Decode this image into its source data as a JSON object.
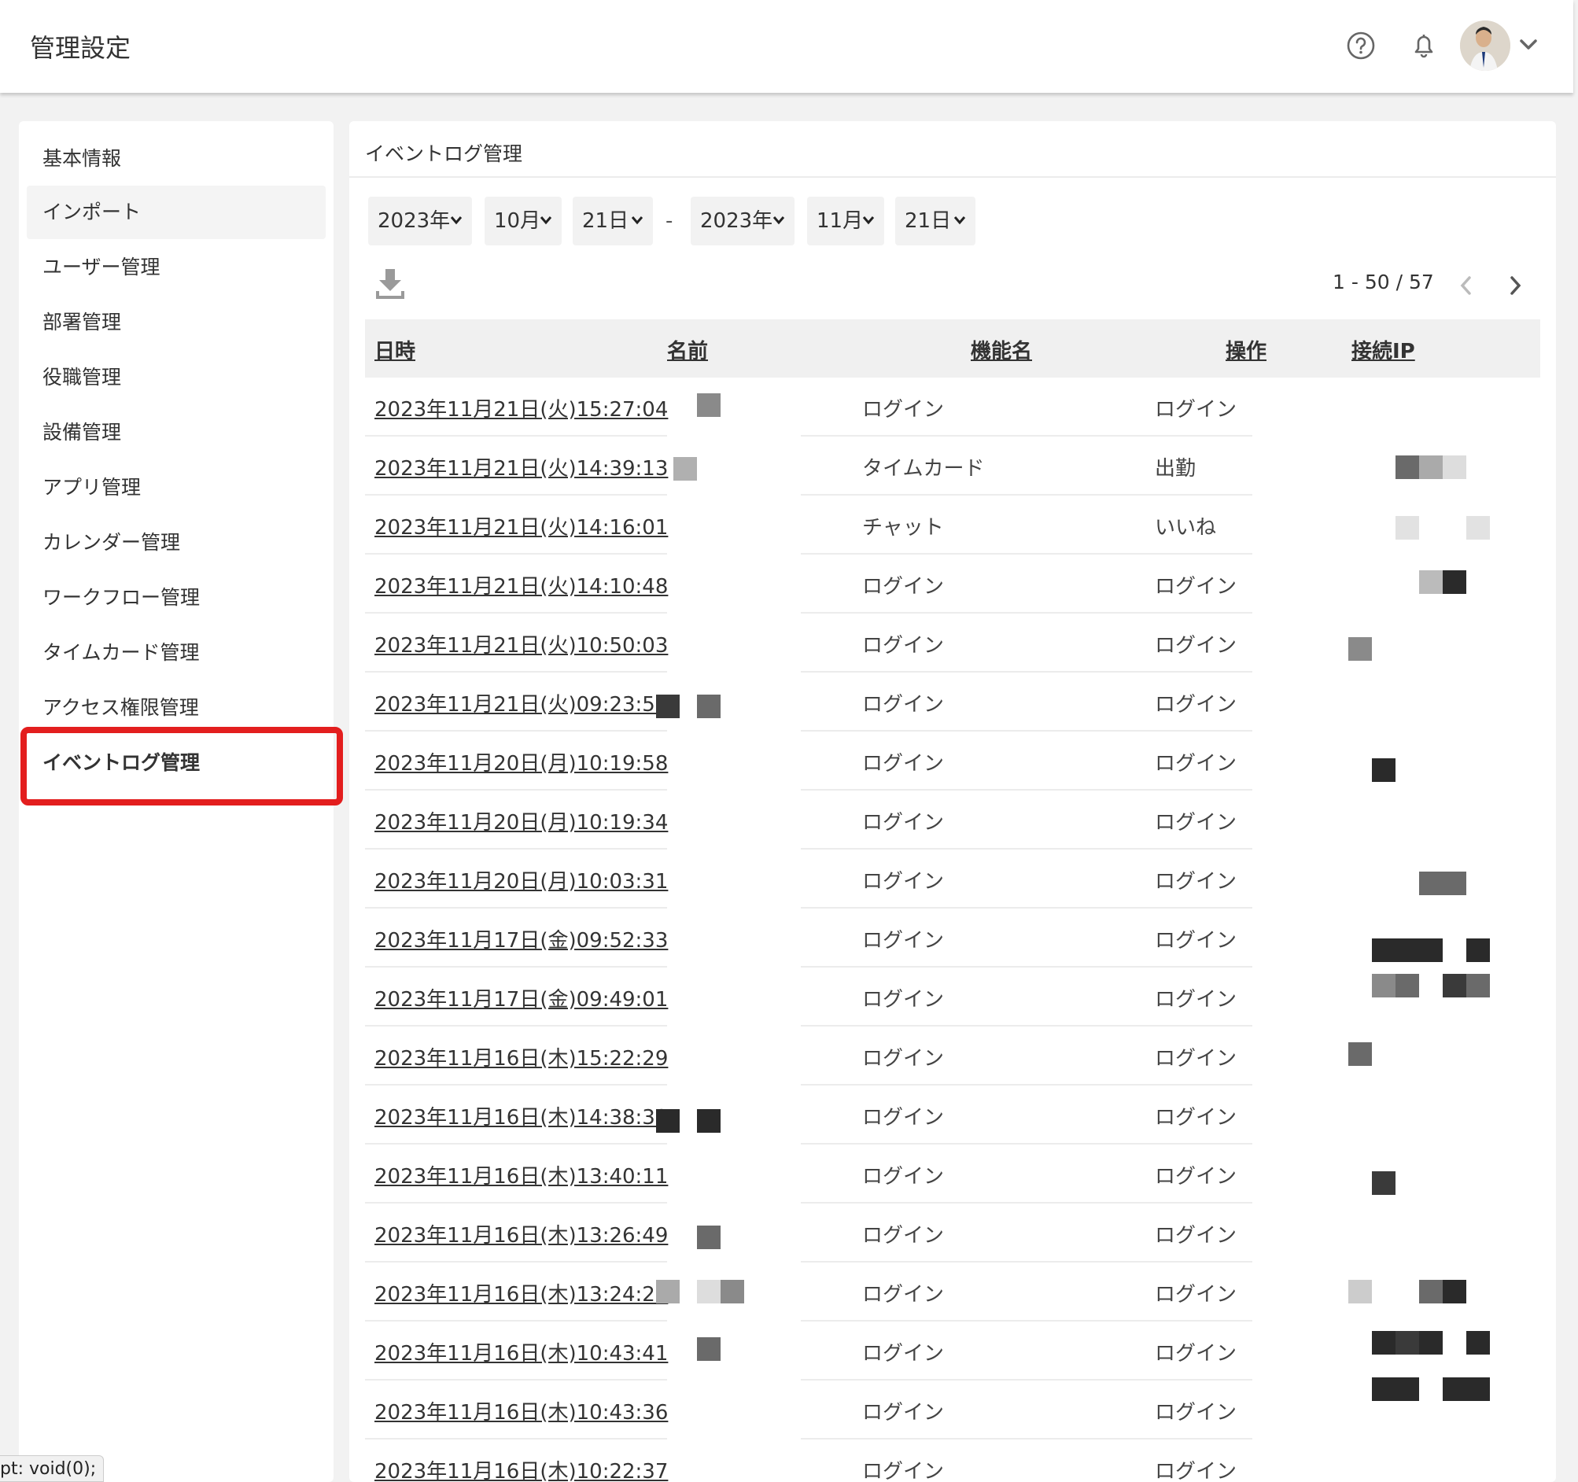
{
  "header": {
    "title": "管理設定",
    "icons": [
      "help-icon",
      "bell-icon",
      "avatar",
      "chevron-down-icon"
    ]
  },
  "sidebar": {
    "items": [
      {
        "label": "基本情報"
      },
      {
        "label": "インポート"
      },
      {
        "label": "ユーザー管理"
      },
      {
        "label": "部署管理"
      },
      {
        "label": "役職管理"
      },
      {
        "label": "設備管理"
      },
      {
        "label": "アプリ管理"
      },
      {
        "label": "カレンダー管理"
      },
      {
        "label": "ワークフロー管理"
      },
      {
        "label": "タイムカード管理"
      },
      {
        "label": "アクセス権限管理"
      },
      {
        "label": "イベントログ管理"
      }
    ],
    "active_index": 11,
    "highlight_color": "#e31e1e"
  },
  "main": {
    "title": "イベントログ管理",
    "filters": {
      "from": {
        "year": "2023年",
        "month": "10月",
        "day": "21日"
      },
      "separator": "-",
      "to": {
        "year": "2023年",
        "month": "11月",
        "day": "21日"
      }
    },
    "pager": "1 - 50 / 57",
    "columns": [
      "日時",
      "名前",
      "機能名",
      "操作",
      "接続IP"
    ],
    "rows": [
      {
        "datetime": "2023年11月21日(火)15:27:04",
        "function": "ログイン",
        "operation": "ログイン"
      },
      {
        "datetime": "2023年11月21日(火)14:39:13",
        "function": "タイムカード",
        "operation": "出勤"
      },
      {
        "datetime": "2023年11月21日(火)14:16:01",
        "function": "チャット",
        "operation": "いいね"
      },
      {
        "datetime": "2023年11月21日(火)14:10:48",
        "function": "ログイン",
        "operation": "ログイン"
      },
      {
        "datetime": "2023年11月21日(火)10:50:03",
        "function": "ログイン",
        "operation": "ログイン"
      },
      {
        "datetime": "2023年11月21日(火)09:23:52",
        "function": "ログイン",
        "operation": "ログイン"
      },
      {
        "datetime": "2023年11月20日(月)10:19:58",
        "function": "ログイン",
        "operation": "ログイン"
      },
      {
        "datetime": "2023年11月20日(月)10:19:34",
        "function": "ログイン",
        "operation": "ログイン"
      },
      {
        "datetime": "2023年11月20日(月)10:03:31",
        "function": "ログイン",
        "operation": "ログイン"
      },
      {
        "datetime": "2023年11月17日(金)09:52:33",
        "function": "ログイン",
        "operation": "ログイン"
      },
      {
        "datetime": "2023年11月17日(金)09:49:01",
        "function": "ログイン",
        "operation": "ログイン"
      },
      {
        "datetime": "2023年11月16日(木)15:22:29",
        "function": "ログイン",
        "operation": "ログイン"
      },
      {
        "datetime": "2023年11月16日(木)14:38:39",
        "function": "ログイン",
        "operation": "ログイン"
      },
      {
        "datetime": "2023年11月16日(木)13:40:11",
        "function": "ログイン",
        "operation": "ログイン"
      },
      {
        "datetime": "2023年11月16日(木)13:26:49",
        "function": "ログイン",
        "operation": "ログイン"
      },
      {
        "datetime": "2023年11月16日(木)13:24:26",
        "function": "ログイン",
        "operation": "ログイン"
      },
      {
        "datetime": "2023年11月16日(木)10:43:41",
        "function": "ログイン",
        "operation": "ログイン"
      },
      {
        "datetime": "2023年11月16日(木)10:43:36",
        "function": "ログイン",
        "operation": "ログイン"
      },
      {
        "datetime": "2023年11月16日(木)10:22:37",
        "function": "ログイン",
        "operation": "ログイン"
      }
    ]
  },
  "statusbar": {
    "text": "pt: void(0);"
  }
}
